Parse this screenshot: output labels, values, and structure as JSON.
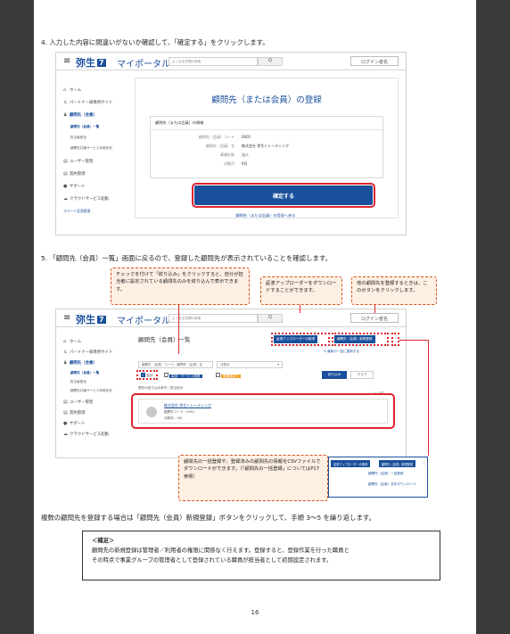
{
  "step4": {
    "text": "4.  入力した内容に間違いがないか確認して、「確定する」をクリックします。"
  },
  "step5": {
    "text": "5.  「顧問先（会員）一覧」画面に戻るので、登録した顧問先が表示されていることを確認します。"
  },
  "app": {
    "logo": "弥生",
    "logo_mark": "7",
    "portal": "マイポータル",
    "search_placeholder": "よくある質問の検索",
    "search_icon": "search-icon",
    "login": "ログイン者名"
  },
  "sidebar": {
    "items": [
      {
        "label": "ホーム",
        "icon": "home-icon"
      },
      {
        "label": "パートナー様専用サイト",
        "icon": "person-icon"
      },
      {
        "label": "顧問先（会員）",
        "icon": "group-icon"
      },
      {
        "label": "顧問先（会員）一覧"
      },
      {
        "label": "担当者設定"
      },
      {
        "label": "顧問先共通サービス利用状況"
      },
      {
        "label": "ユーザー管理",
        "icon": "document-icon"
      },
      {
        "label": "契約管理",
        "icon": "document-icon"
      },
      {
        "label": "サポート",
        "icon": "help-icon"
      },
      {
        "label": "クラウドサービス起動",
        "icon": "cloud-icon"
      },
      {
        "label": "スマート証憑管理"
      }
    ]
  },
  "register": {
    "title": "顧問先（または会員）の登録",
    "info_head": "顧問先（または会員）の情報",
    "rows": [
      {
        "k": "顧問先（会員）コード",
        "v": "0001"
      },
      {
        "k": "顧問先（会員）名",
        "v": "株式会社 弥生トレーディング"
      },
      {
        "k": "事業形態",
        "v": "法人"
      },
      {
        "k": "決算月",
        "v": "9月"
      }
    ],
    "confirm_label": "確定する",
    "back_label": "顧問先（または会員）の登録へ戻る"
  },
  "callouts": {
    "c1": "チェックを付けて「絞り込み」をクリックすると、自分が担当者に設定されている顧問先のみを絞り込んで表示できます。",
    "c2": "証憑アップローダーをダウンロードすることができます。",
    "c3": "他の顧問先を登録するときは、このボタンをクリックします。",
    "c4": "顧問先の一括登録や、登録済みの顧問先の情報をCSVファイルでダウンロードができます。（「顧問先の一括登録」についてはP17参照）"
  },
  "list": {
    "title": "顧問先（会員）一覧",
    "btn_uploader": "証憑アップローダーの取得",
    "btn_register": "顧問先（会員）新規登録",
    "refresh": "最新の一覧に更新する",
    "filter_placeholder": "顧問先（会員）コード、顧問先（会員）名",
    "filter_month": "決算月",
    "chk_mine": "自分",
    "chk_products": "製品・サービス連携",
    "chk_alert": "要確認あり",
    "btn_filter": "絞り込み",
    "btn_clear": "クリア",
    "condition": "現在の絞り込み条件：担当自分",
    "count": "1 / 1件",
    "client_name": "株式会社 弥生トレーディング",
    "client_code": "顧問先コード：0001",
    "client_month": "決算月：9月",
    "inset_b1": "証憑アップローダーの取得",
    "inset_b2": "顧問先（会員）新規登録",
    "inset_m1": "顧問先（会員）一括登録",
    "inset_m2": "顧問先（会員）全件ダウンロード"
  },
  "repeat_note": "複数の顧問先を登録する場合は「顧問先（会員）新規登録」ボタンをクリックして、手順 3～5 を繰り返します。",
  "supplement": {
    "head": "＜補足＞",
    "line1": "顧問先の新規登録は管理者／利用者の権限に関係なく行えます。登録すると、登録作業を行った職員と",
    "line2": "その時点で事業グループの管理者として登録されている職員が担当者として初期設定されます。"
  },
  "page_number": "16"
}
